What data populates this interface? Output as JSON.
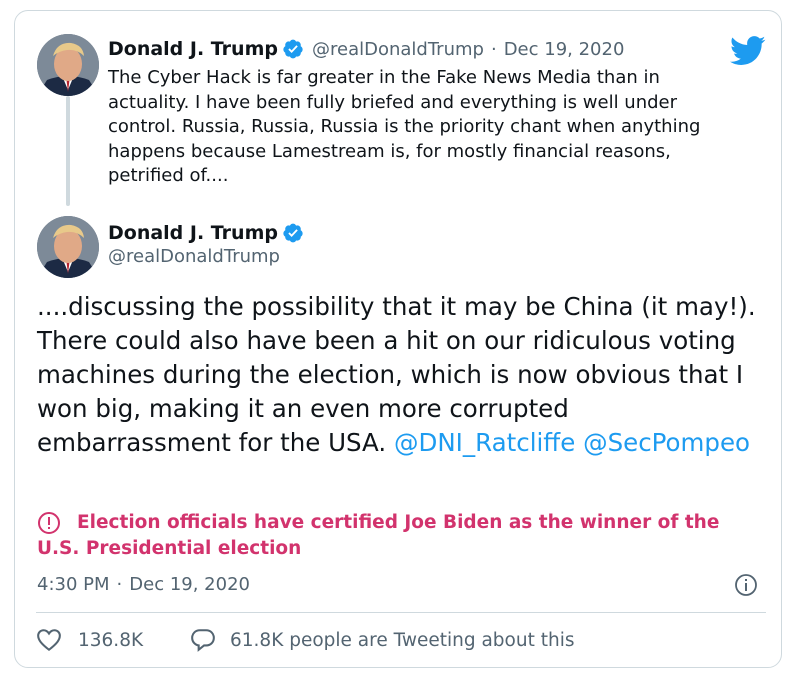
{
  "first_tweet": {
    "display_name": "Donald J. Trump",
    "handle": "@realDonaldTrump",
    "separator": "·",
    "date": "Dec 19, 2020",
    "text": "The Cyber Hack is far greater in the Fake News Media than in actuality. I have been fully briefed and everything is well under control. Russia, Russia, Russia is the priority chant when anything happens because Lamestream is, for mostly financial reasons, petrified of...."
  },
  "main_tweet": {
    "display_name": "Donald J. Trump",
    "handle": "@realDonaldTrump",
    "text": "....discussing the possibility that it may be China (it may!). There could also have been a hit on our ridiculous voting machines during the election, which is now obvious that I won big, making it an even more corrupted embarrassment for the USA.",
    "mention_1": "@DNI_Ratcliffe",
    "mention_2": "@SecPompeo",
    "notice": "Election officials have certified Joe Biden as the winner of the U.S. Presidential election",
    "time": "4:30 PM",
    "separator": "·",
    "date": "Dec 19, 2020",
    "likes": "136.8K",
    "conversation": "61.8K people are Tweeting about this"
  },
  "icons": {
    "brand": "twitter-bird-icon",
    "verified": "verified-badge-icon",
    "notice": "exclamation-circle-icon",
    "info": "info-icon",
    "like": "heart-icon",
    "reply": "speech-bubble-icon"
  },
  "colors": {
    "accent": "#1d9bf0",
    "notice": "#d2336d",
    "muted": "#536471",
    "text": "#0f1419",
    "border": "#cfd9de"
  }
}
